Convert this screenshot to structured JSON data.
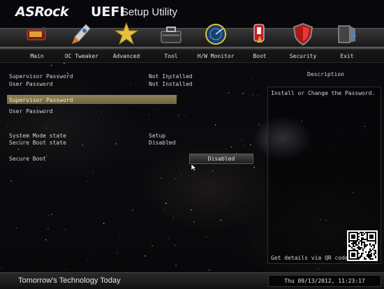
{
  "header": {
    "brand": "ASRock",
    "product": "UEFI",
    "product_sub": "Setup Utility"
  },
  "nav": [
    {
      "label": "Main",
      "icon": "main-icon"
    },
    {
      "label": "OC Tweaker",
      "icon": "rocket-icon"
    },
    {
      "label": "Advanced",
      "icon": "star-icon"
    },
    {
      "label": "Tool",
      "icon": "toolbox-icon"
    },
    {
      "label": "H/W Monitor",
      "icon": "radar-icon"
    },
    {
      "label": "Boot",
      "icon": "boot-icon"
    },
    {
      "label": "Security",
      "icon": "shield-icon"
    },
    {
      "label": "Exit",
      "icon": "exit-door-icon"
    }
  ],
  "settings": {
    "supervisor_password_label": "Supervisor Password",
    "supervisor_password_value": "Not Installed",
    "user_password_label": "User Password",
    "user_password_value": "Not Installed",
    "supervisor_password_action": "Supervisor Password",
    "user_password_action": "User Password",
    "system_mode_label": "System Mode state",
    "system_mode_value": "Setup",
    "secure_boot_state_label": "Secure Boot state",
    "secure_boot_state_value": "Disabled",
    "secure_boot_label": "Secure Boot",
    "secure_boot_value": "Disabled"
  },
  "description": {
    "title": "Description",
    "text": "Install or Change the Password.",
    "qr_caption": "Get details via QR code"
  },
  "footer": {
    "tagline": "Tomorrow's Technology Today",
    "datetime": "Thu 09/13/2012, 11:23:17"
  },
  "colors": {
    "selection": "#8f8355",
    "background": "#05060a",
    "text": "#d6d6d6"
  }
}
